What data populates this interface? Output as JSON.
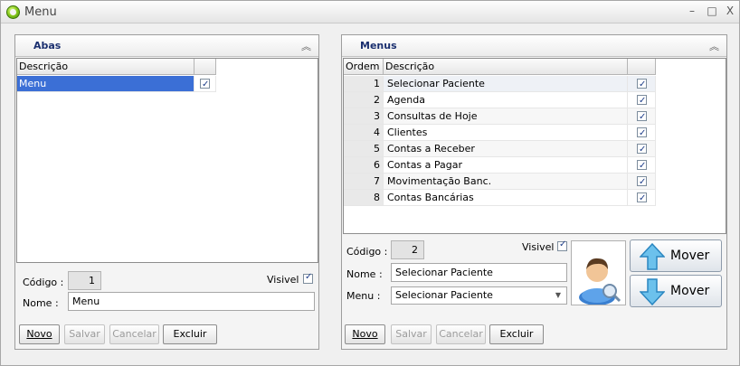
{
  "window": {
    "title": "Menu",
    "min_label": "–",
    "max_label": "□",
    "close_label": "X"
  },
  "left_panel": {
    "title": "Abas",
    "grid": {
      "col_descricao": "Descrição",
      "rows": [
        {
          "descricao": "Menu",
          "checked": true
        }
      ]
    },
    "codigo_label": "Código :",
    "codigo_value": "1",
    "visivel_label": "Visivel",
    "nome_label": "Nome :",
    "nome_value": "Menu",
    "buttons": {
      "novo": "Novo",
      "salvar": "Salvar",
      "cancelar": "Cancelar",
      "excluir": "Excluir"
    }
  },
  "right_panel": {
    "title": "Menus",
    "grid": {
      "col_ordem": "Ordem",
      "col_descricao": "Descrição",
      "rows": [
        {
          "ordem": "1",
          "descricao": "Selecionar Paciente",
          "checked": true
        },
        {
          "ordem": "2",
          "descricao": "Agenda",
          "checked": true
        },
        {
          "ordem": "3",
          "descricao": "Consultas de Hoje",
          "checked": true
        },
        {
          "ordem": "4",
          "descricao": "Clientes",
          "checked": true
        },
        {
          "ordem": "5",
          "descricao": "Contas a Receber",
          "checked": true
        },
        {
          "ordem": "6",
          "descricao": "Contas a Pagar",
          "checked": true
        },
        {
          "ordem": "7",
          "descricao": "Movimentação Banc.",
          "checked": true
        },
        {
          "ordem": "8",
          "descricao": "Contas Bancárias",
          "checked": true
        }
      ]
    },
    "codigo_label": "Código :",
    "codigo_value": "2",
    "visivel_label": "Visivel",
    "nome_label": "Nome :",
    "nome_value": "Selecionar Paciente",
    "menu_label": "Menu :",
    "menu_value": "Selecionar Paciente",
    "mover_up_label": "Mover",
    "mover_down_label": "Mover",
    "buttons": {
      "novo": "Novo",
      "salvar": "Salvar",
      "cancelar": "Cancelar",
      "excluir": "Excluir"
    }
  }
}
